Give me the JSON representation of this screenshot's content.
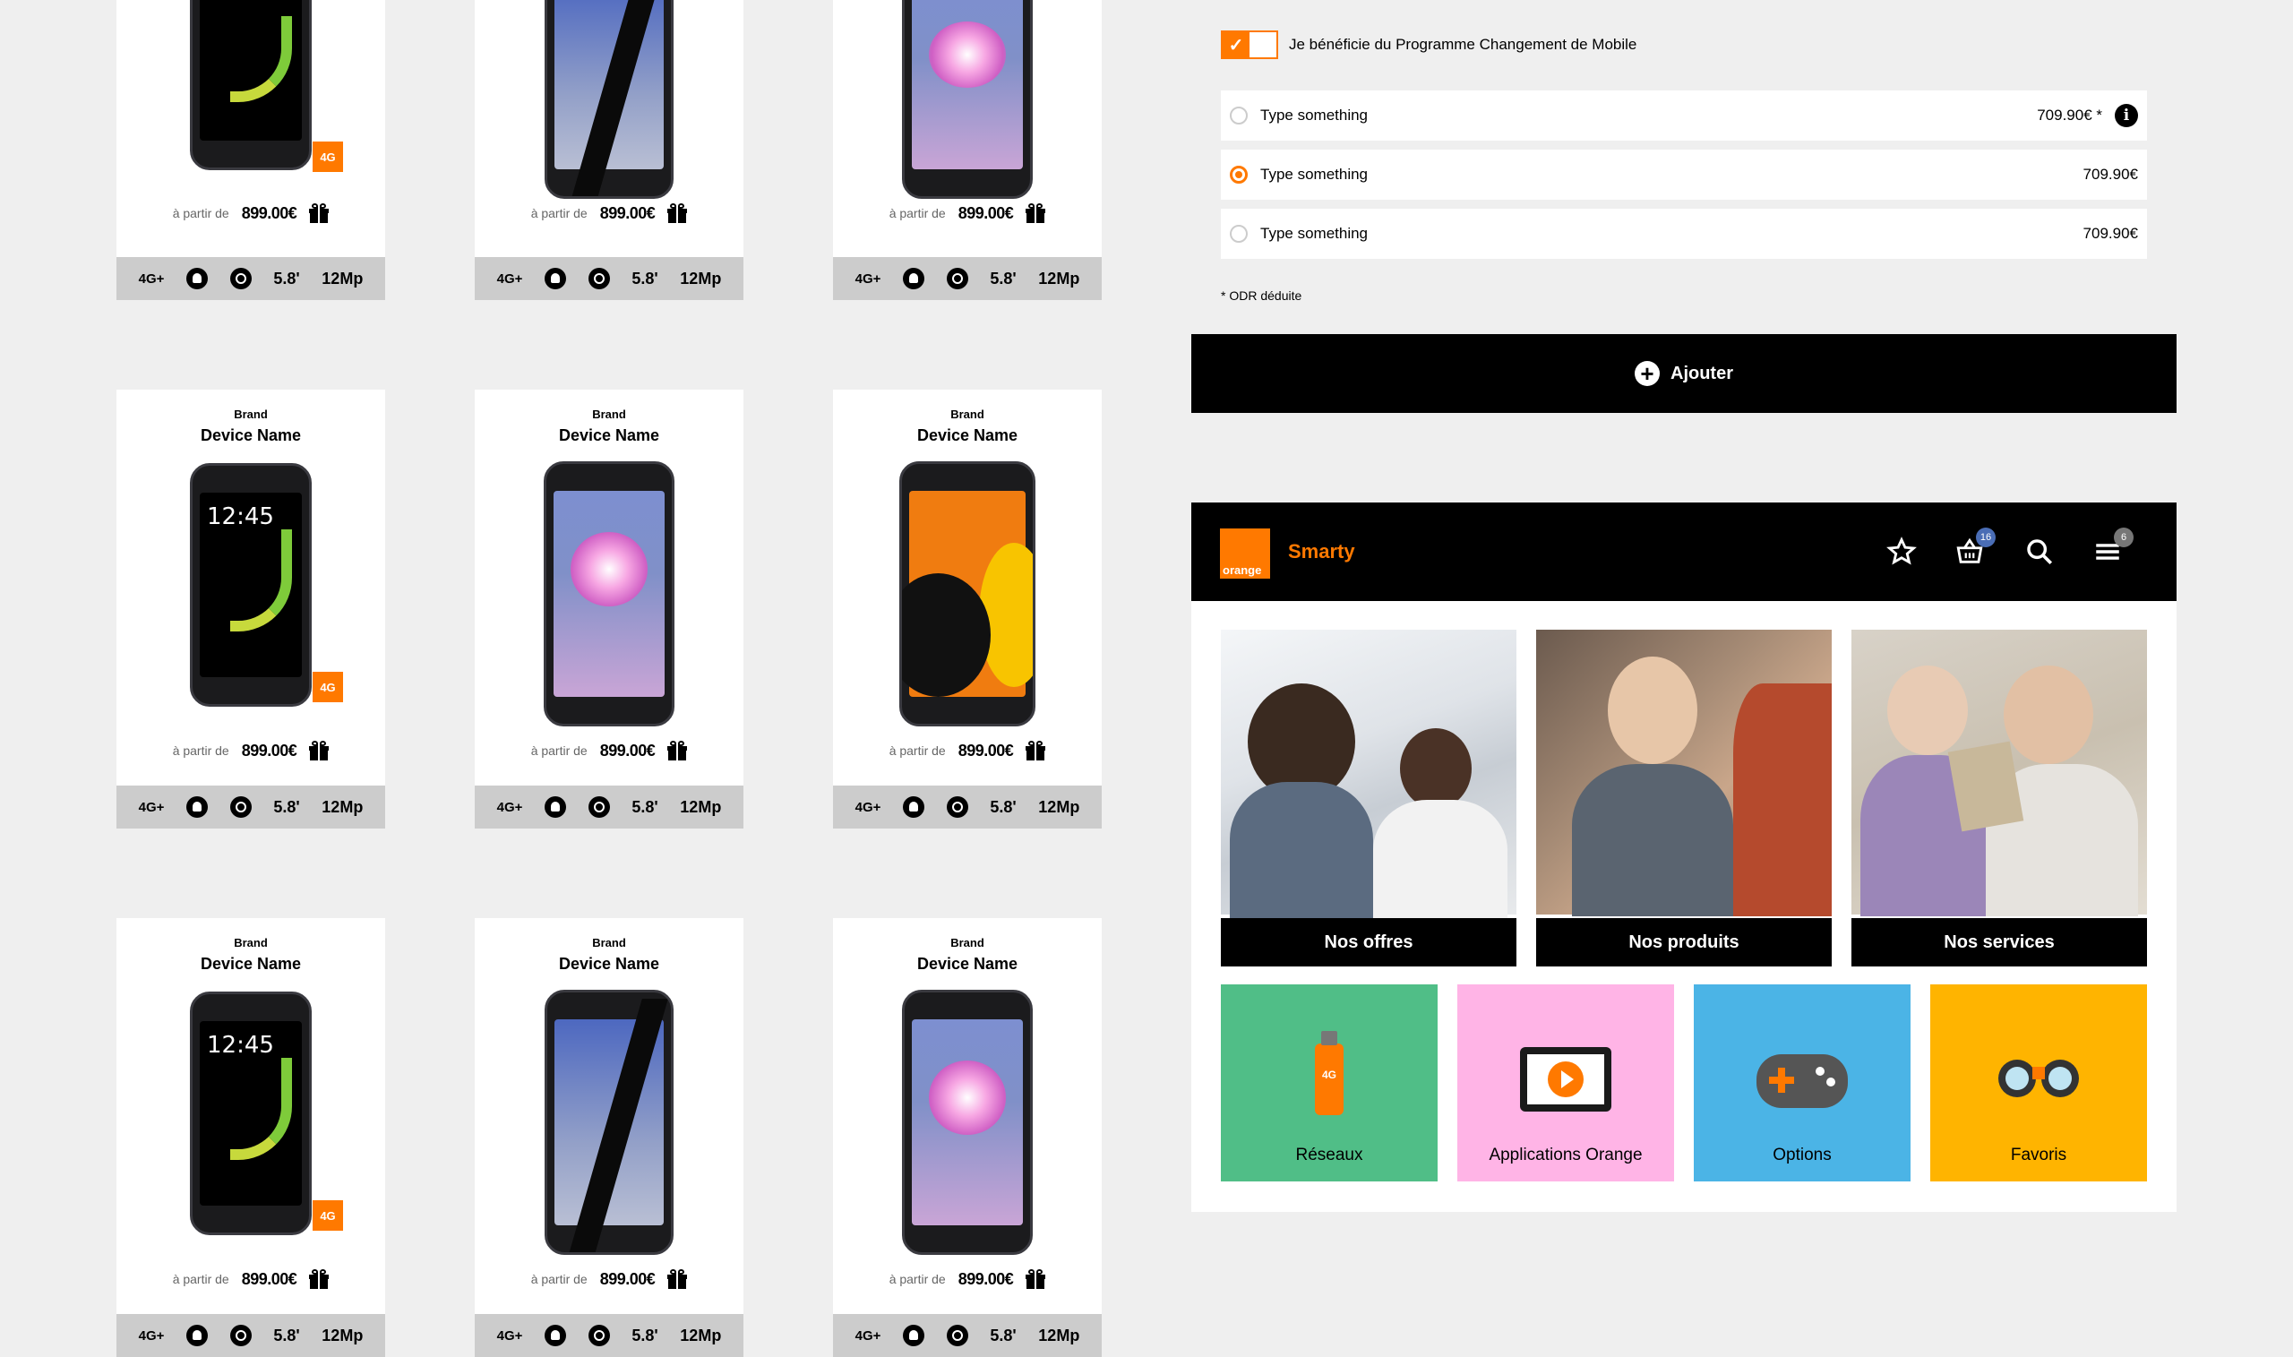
{
  "product_grid": [
    {
      "brand": "",
      "name": "",
      "from": "à partir de",
      "price": "899.00€",
      "badge": "4G",
      "specs": {
        "net": "4G+",
        "screen": "5.8'",
        "camera": "12Mp"
      }
    },
    {
      "brand": "",
      "name": "",
      "from": "à partir de",
      "price": "899.00€",
      "badge": "",
      "specs": {
        "net": "4G+",
        "screen": "5.8'",
        "camera": "12Mp"
      }
    },
    {
      "brand": "",
      "name": "",
      "from": "à partir de",
      "price": "899.00€",
      "badge": "",
      "specs": {
        "net": "4G+",
        "screen": "5.8'",
        "camera": "12Mp"
      }
    },
    {
      "brand": "Brand",
      "name": "Device Name",
      "from": "à partir de",
      "price": "899.00€",
      "badge": "4G",
      "specs": {
        "net": "4G+",
        "screen": "5.8'",
        "camera": "12Mp"
      }
    },
    {
      "brand": "Brand",
      "name": "Device Name",
      "from": "à partir de",
      "price": "899.00€",
      "badge": "",
      "specs": {
        "net": "4G+",
        "screen": "5.8'",
        "camera": "12Mp"
      }
    },
    {
      "brand": "Brand",
      "name": "Device Name",
      "from": "à partir de",
      "price": "899.00€",
      "badge": "",
      "specs": {
        "net": "4G+",
        "screen": "5.8'",
        "camera": "12Mp"
      }
    },
    {
      "brand": "Brand",
      "name": "Device Name",
      "from": "à partir de",
      "price": "899.00€",
      "badge": "4G",
      "specs": {
        "net": "4G+",
        "screen": "5.8'",
        "camera": "12Mp"
      }
    },
    {
      "brand": "Brand",
      "name": "Device Name",
      "from": "à partir de",
      "price": "899.00€",
      "badge": "",
      "specs": {
        "net": "4G+",
        "screen": "5.8'",
        "camera": "12Mp"
      }
    },
    {
      "brand": "Brand",
      "name": "Device Name",
      "from": "à partir de",
      "price": "899.00€",
      "badge": "",
      "specs": {
        "net": "4G+",
        "screen": "5.8'",
        "camera": "12Mp"
      }
    }
  ],
  "program": {
    "label": "Je bénéficie du Programme Changement de Mobile",
    "checked": true
  },
  "options": [
    {
      "label": "Type something",
      "price": "709.90€ *",
      "selected": false
    },
    {
      "label": "Type something",
      "price": "709.90€",
      "selected": true
    },
    {
      "label": "Type something",
      "price": "709.90€",
      "selected": false
    }
  ],
  "odr_note": "* ODR déduite",
  "add_button": "Ajouter",
  "navbar": {
    "logo": "orange",
    "app_name": "Smarty",
    "basket_count": "16",
    "menu_count": "6"
  },
  "tiles": [
    "Nos offres",
    "Nos produits",
    "Nos services"
  ],
  "categories": [
    {
      "label": "Réseaux",
      "color": "#50be87",
      "icon_text": "4G"
    },
    {
      "label": "Applications Orange",
      "color": "#ffb4e6",
      "icon_text": ""
    },
    {
      "label": "Options",
      "color": "#4bb4e6",
      "icon_text": ""
    },
    {
      "label": "Favoris",
      "color": "#ffb400",
      "icon_text": ""
    }
  ],
  "colors": {
    "accent": "#ff7900",
    "background": "#efefef"
  }
}
